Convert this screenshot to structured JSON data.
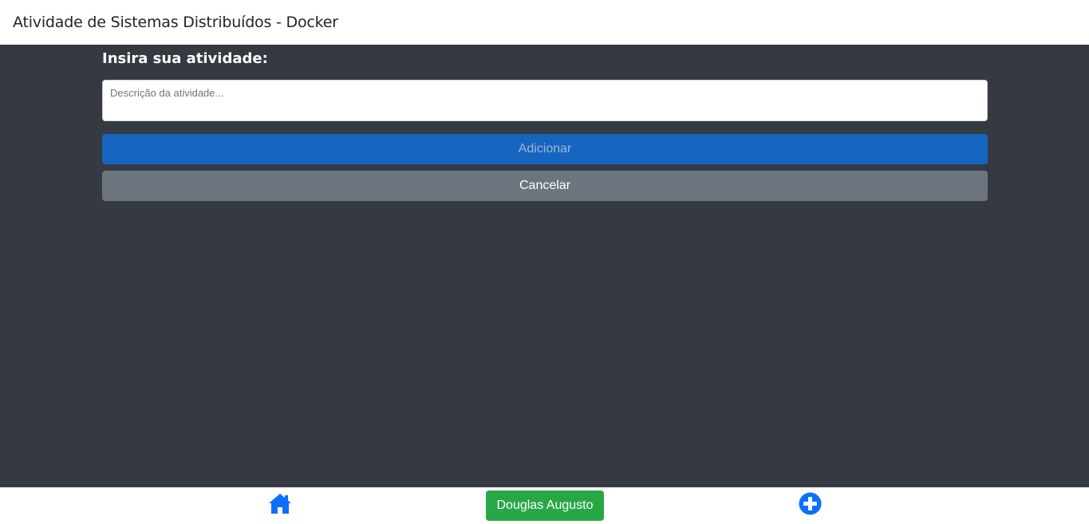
{
  "header": {
    "title": "Atividade de Sistemas Distribuídos - Docker"
  },
  "form": {
    "heading": "Insira sua atividade:",
    "description_placeholder": "Descrição da atividade...",
    "description_value": "",
    "add_label": "Adicionar",
    "cancel_label": "Cancelar"
  },
  "footer": {
    "home_icon": "home-icon",
    "user_label": "Douglas Augusto",
    "add_icon": "plus-circle-icon"
  },
  "colors": {
    "background": "#353942",
    "primary": "#1565c0",
    "secondary": "#6c757d",
    "success": "#28a745",
    "icon_blue": "#0d6efd"
  }
}
